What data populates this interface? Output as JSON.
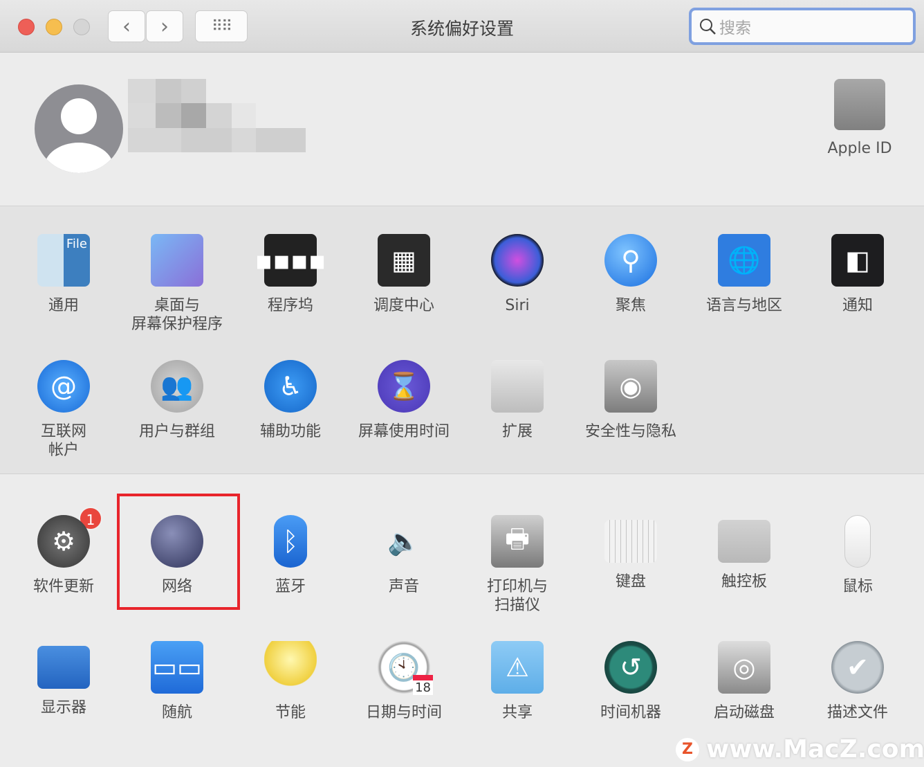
{
  "window": {
    "title": "系统偏好设置",
    "search_placeholder": "搜索"
  },
  "header": {
    "apple_id_label": "Apple ID"
  },
  "sections": [
    [
      {
        "id": "general",
        "label": "通用",
        "icon": "general-icon",
        "bg": "linear-gradient(90deg,#cfe3f0 50%,#3d7fbf 50%)",
        "glyph": "File"
      },
      {
        "id": "desktop",
        "label": "桌面与\n屏幕保护程序",
        "icon": "desktop-screensaver-icon",
        "bg": "linear-gradient(135deg,#7ab8f5,#8a6fd8)",
        "glyph": ""
      },
      {
        "id": "dock",
        "label": "程序坞",
        "icon": "dock-icon",
        "bg": "#222",
        "glyph": "▪▪▪▪"
      },
      {
        "id": "mission",
        "label": "调度中心",
        "icon": "mission-control-icon",
        "bg": "#2a2a2a",
        "glyph": "▦"
      },
      {
        "id": "siri",
        "label": "Siri",
        "icon": "siri-icon",
        "bg": "radial-gradient(circle,#d04fe0,#3b5ed8 60%,#111 72%)",
        "glyph": "",
        "round": true
      },
      {
        "id": "spotlight",
        "label": "聚焦",
        "icon": "spotlight-icon",
        "bg": "radial-gradient(circle at 40% 35%,#7fc4ff,#1a6fe0)",
        "glyph": "⚲",
        "round": true
      },
      {
        "id": "language",
        "label": "语言与地区",
        "icon": "language-region-icon",
        "bg": "#2f7de0",
        "glyph": "🌐"
      },
      {
        "id": "notifications",
        "label": "通知",
        "icon": "notifications-icon",
        "bg": "#1d1d1f",
        "glyph": "◧"
      }
    ],
    [
      {
        "id": "internet",
        "label": "互联网\n帐户",
        "icon": "internet-accounts-icon",
        "bg": "radial-gradient(circle,#5ab0ff,#1769d6)",
        "glyph": "@",
        "round": true
      },
      {
        "id": "users",
        "label": "用户与群组",
        "icon": "users-groups-icon",
        "bg": "radial-gradient(circle,#d8d8d8,#a0a0a0)",
        "glyph": "👥",
        "round": true
      },
      {
        "id": "accessibility",
        "label": "辅助功能",
        "icon": "accessibility-icon",
        "bg": "radial-gradient(circle,#3d9cf5,#1566c8)",
        "glyph": "♿",
        "round": true
      },
      {
        "id": "screentime",
        "label": "屏幕使用时间",
        "icon": "screen-time-icon",
        "bg": "radial-gradient(circle,#6a5ad8,#4a37b5)",
        "glyph": "⌛",
        "round": true
      },
      {
        "id": "extensions",
        "label": "扩展",
        "icon": "extensions-icon",
        "bg": "linear-gradient(#e8e8e8,#bdbdbd)",
        "glyph": ""
      },
      {
        "id": "security",
        "label": "安全性与隐私",
        "icon": "security-privacy-icon",
        "bg": "linear-gradient(#c8c8c8,#7d7d7d)",
        "glyph": "◉"
      }
    ],
    [
      {
        "id": "softwareupdate",
        "label": "软件更新",
        "icon": "software-update-icon",
        "bg": "radial-gradient(circle,#777,#333)",
        "glyph": "⚙",
        "round": true,
        "badge": "1"
      },
      {
        "id": "network",
        "label": "网络",
        "icon": "network-icon",
        "bg": "radial-gradient(circle at 40% 35%,#8a8fb8,#2f335a)",
        "glyph": "",
        "round": true
      },
      {
        "id": "bluetooth",
        "label": "蓝牙",
        "icon": "bluetooth-icon",
        "bg": "linear-gradient(#4a9cf5,#1a64d0)",
        "glyph": "ᛒ",
        "pill": true
      },
      {
        "id": "sound",
        "label": "声音",
        "icon": "sound-icon",
        "bg": "transparent",
        "glyph": "🔈"
      },
      {
        "id": "printers",
        "label": "打印机与\n扫描仪",
        "icon": "printers-scanners-icon",
        "bg": "linear-gradient(#d0d0d0,#7a7a7a)",
        "glyph": "🖶"
      },
      {
        "id": "keyboard",
        "label": "键盘",
        "icon": "keyboard-icon",
        "bg": "repeating-linear-gradient(90deg,#f2f2f2 0 7px,#c4c4c4 7px 8px)",
        "glyph": "",
        "flat": true
      },
      {
        "id": "trackpad",
        "label": "触控板",
        "icon": "trackpad-icon",
        "bg": "linear-gradient(#d2d2d2,#b8b8b8)",
        "glyph": "",
        "flat": true
      },
      {
        "id": "mouse",
        "label": "鼠标",
        "icon": "mouse-icon",
        "bg": "linear-gradient(#fff,#e4e4e4)",
        "glyph": "",
        "mouse": true
      }
    ],
    [
      {
        "id": "displays",
        "label": "显示器",
        "icon": "displays-icon",
        "bg": "linear-gradient(#4a8fe0,#2364c0)",
        "glyph": "",
        "flat": true
      },
      {
        "id": "sidecar",
        "label": "随航",
        "icon": "sidecar-icon",
        "bg": "linear-gradient(#4aa0f5,#1f6ad8)",
        "glyph": "▭▭"
      },
      {
        "id": "energy",
        "label": "节能",
        "icon": "energy-saver-icon",
        "bg": "radial-gradient(circle at 50% 35%,#fff8b0,#f0d040 60%,transparent 62%)",
        "glyph": ""
      },
      {
        "id": "datetime",
        "label": "日期与时间",
        "icon": "date-time-icon",
        "bg": "radial-gradient(circle,#fff 60%,#999 64%,#ddd 70%)",
        "glyph": "🕙",
        "round": true,
        "cal": "18"
      },
      {
        "id": "sharing",
        "label": "共享",
        "icon": "sharing-icon",
        "bg": "linear-gradient(#8ecbf5,#5eaee8)",
        "glyph": "⚠"
      },
      {
        "id": "timemachine",
        "label": "时间机器",
        "icon": "time-machine-icon",
        "bg": "radial-gradient(circle,#2d8a7a 55%,#1b4f48 60%,#0e2b28)",
        "glyph": "↺",
        "round": true
      },
      {
        "id": "startup",
        "label": "启动磁盘",
        "icon": "startup-disk-icon",
        "bg": "linear-gradient(#ddd,#8a8a8a)",
        "glyph": "◎"
      },
      {
        "id": "profiles",
        "label": "描述文件",
        "icon": "profiles-icon",
        "bg": "radial-gradient(circle,#c6cdd2 60%,#8b949b 70%)",
        "glyph": "✔",
        "round": true
      }
    ]
  ],
  "watermark": "www.MacZ.com",
  "colors": {
    "highlight": "#e8242b",
    "badge": "#e9463d",
    "search_focus": "#7fa0e0"
  }
}
